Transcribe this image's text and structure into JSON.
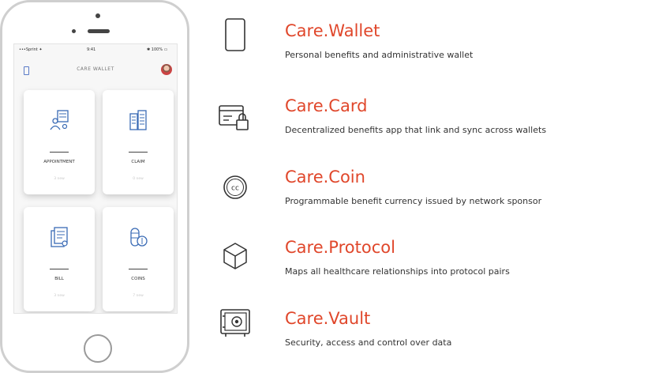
{
  "phone": {
    "status_bar": {
      "left": "•••Sprint ✦",
      "center": "9:41",
      "right": "✱ 100% ▭"
    },
    "app_title": "CARE WALLET",
    "cards": [
      {
        "label": "APPOINTMENT",
        "sub": "3 new",
        "icon": "appointment-icon"
      },
      {
        "label": "CLAIM",
        "sub": "0 new",
        "icon": "claim-icon"
      },
      {
        "label": "BILL",
        "sub": "3 new",
        "icon": "bill-icon"
      },
      {
        "label": "COINS",
        "sub": "7 new",
        "icon": "coins-icon"
      }
    ]
  },
  "features": [
    {
      "title": "Care.Wallet",
      "description": "Personal benefits and administrative wallet",
      "icon": "smartphone-icon"
    },
    {
      "title": "Care.Card",
      "description": "Decentralized benefits app that link and sync across wallets",
      "icon": "card-lock-icon"
    },
    {
      "title": "Care.Coin",
      "description": "Programmable benefit currency issued by network sponsor",
      "icon": "coin-icon"
    },
    {
      "title": "Care.Protocol",
      "description": "Maps all healthcare relationships into protocol pairs",
      "icon": "cube-icon"
    },
    {
      "title": "Care.Vault",
      "description": "Security, access and control over data",
      "icon": "vault-icon"
    }
  ],
  "colors": {
    "accent": "#e0472b",
    "text": "#333333",
    "phone_frame": "#cfcfcf"
  }
}
